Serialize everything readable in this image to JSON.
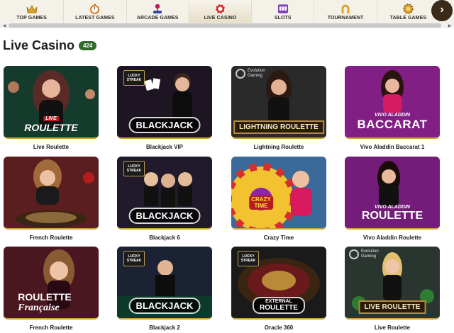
{
  "nav": {
    "items": [
      {
        "label": "TOP GAMES",
        "icon": "crown-icon"
      },
      {
        "label": "LATEST GAMES",
        "icon": "stopwatch-icon"
      },
      {
        "label": "ARCADE GAMES",
        "icon": "joystick-icon"
      },
      {
        "label": "LIVE CASINO",
        "icon": "roulette-chip-icon",
        "active": true
      },
      {
        "label": "SLOTS",
        "icon": "slot-machine-icon"
      },
      {
        "label": "TOURNAMENT",
        "icon": "horseshoe-icon"
      },
      {
        "label": "TABLE GAMES",
        "icon": "table-chip-icon"
      }
    ],
    "next_icon": "chevron-right-icon",
    "scroll_left": "◀",
    "scroll_right": "▶"
  },
  "section": {
    "title": "Live Casino",
    "count": "424"
  },
  "games": [
    {
      "caption": "Live Roulette",
      "logo_top": "LIVE",
      "logo": "ROULETTE"
    },
    {
      "caption": "Blackjack VIP",
      "badge_top": "LUCKY",
      "badge_bottom": "STREAK",
      "logo": "BLACKJACK"
    },
    {
      "caption": "Lightning Roulette",
      "provider_top": "Evolution",
      "provider_bottom": "Gaming",
      "logo": "LIGHTNING ROULETTE"
    },
    {
      "caption": "Vivo Aladdin Baccarat 1",
      "logo_top": "VIVO ALADDIN",
      "logo": "BACCARAT"
    },
    {
      "caption": "French Roulette",
      "logo": ""
    },
    {
      "caption": "Blackjack 6",
      "badge_top": "LUCKY",
      "badge_bottom": "STREAK",
      "logo": "BLACKJACK"
    },
    {
      "caption": "Crazy Time",
      "logo_top": "CRAZY",
      "logo": "TIME"
    },
    {
      "caption": "Vivo Aladdin Roulette",
      "logo_top": "VIVO ALADDIN",
      "logo": "ROULETTE"
    },
    {
      "caption": "French Roulette",
      "logo_top": "ROULETTE",
      "logo": "Française"
    },
    {
      "caption": "Blackjack 2",
      "badge_top": "LUCKY",
      "badge_bottom": "STREAK",
      "logo": "BLACKJACK"
    },
    {
      "caption": "Oracle 360",
      "badge_top": "LUCKY",
      "badge_bottom": "STREAK",
      "logo_top": "EXTERNAL",
      "logo": "ROULETTE"
    },
    {
      "caption": "Live Roulette",
      "provider_top": "Evolution",
      "provider_bottom": "Gaming",
      "logo": "LIVE ROULETTE"
    }
  ]
}
